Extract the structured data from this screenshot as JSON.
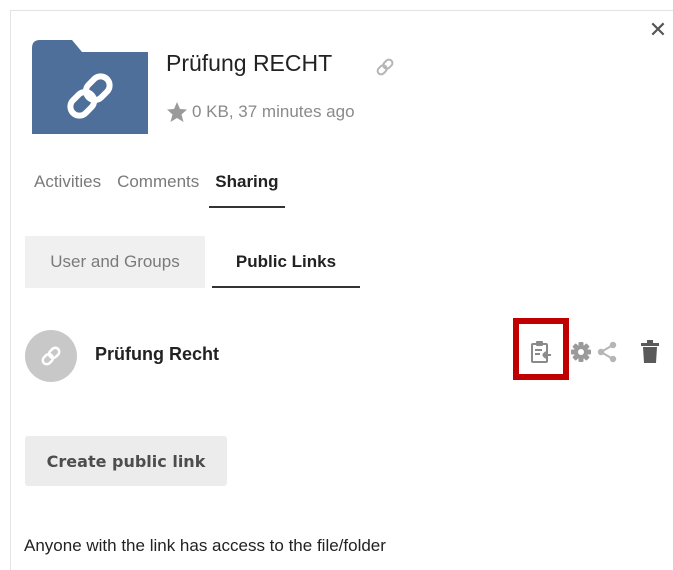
{
  "header": {
    "close_icon": "close-icon",
    "file_title": "Prüfung RECHT",
    "title_icon": "link-icon",
    "meta_icon": "star-icon",
    "meta_text": "0 KB, 37 minutes ago",
    "thumbnail_icon": "folder-link-icon",
    "folder_color": "#4d6f99"
  },
  "tabs": [
    {
      "label": "Activities",
      "active": false
    },
    {
      "label": "Comments",
      "active": false
    },
    {
      "label": "Sharing",
      "active": true
    }
  ],
  "sharing_tabs": [
    {
      "label": "User and Groups",
      "active": false
    },
    {
      "label": "Public Links",
      "active": true
    }
  ],
  "public_link": {
    "avatar_icon": "link-icon",
    "name": "Prüfung Recht",
    "actions": [
      "copy-to-clipboard-icon",
      "gear-icon",
      "share-icon",
      "trash-icon"
    ],
    "highlighted_action": "copy-to-clipboard-icon",
    "highlight_color": "#c00000"
  },
  "create_button_label": "Create public link",
  "access_note": "Anyone with the link has access to the file/folder"
}
